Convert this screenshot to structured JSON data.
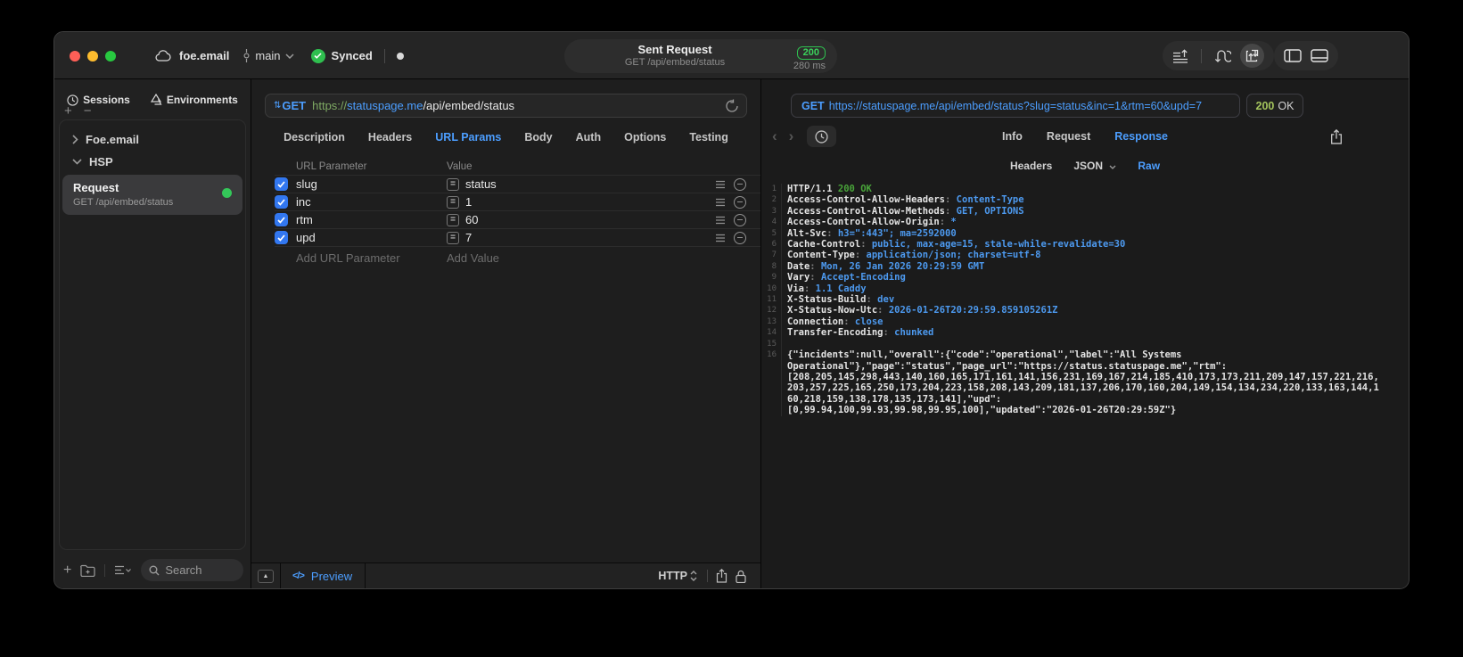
{
  "titlebar": {
    "project": "foe.email",
    "branch": "main",
    "sync_label": "Synced",
    "request_title": "Sent Request",
    "request_subtitle": "GET /api/embed/status",
    "status_badge": "200",
    "duration": "280 ms"
  },
  "sidebar": {
    "tabs": [
      {
        "label": "Sessions"
      },
      {
        "label": "Environments"
      }
    ],
    "tree": [
      {
        "label": "Foe.email"
      },
      {
        "label": "HSP"
      }
    ],
    "request_item": {
      "title": "Request",
      "subtitle": "GET /api/embed/status"
    },
    "search_placeholder": "Search"
  },
  "request_panel": {
    "method": "GET",
    "url": {
      "scheme": "https://",
      "host": "statuspage.me",
      "path": "/api/embed/status"
    },
    "tabs": [
      "Description",
      "Headers",
      "URL Params",
      "Body",
      "Auth",
      "Options",
      "Testing"
    ],
    "active_tab": "URL Params",
    "params": {
      "col_name": "URL Parameter",
      "col_value": "Value",
      "rows": [
        {
          "name": "slug",
          "value": "status",
          "enabled": true
        },
        {
          "name": "inc",
          "value": "1",
          "enabled": true
        },
        {
          "name": "rtm",
          "value": "60",
          "enabled": true
        },
        {
          "name": "upd",
          "value": "7",
          "enabled": true
        }
      ],
      "add_name": "Add URL Parameter",
      "add_value": "Add Value"
    },
    "footer": {
      "preview": "Preview",
      "protocol": "HTTP"
    }
  },
  "response_panel": {
    "method": "GET",
    "url": "https://statuspage.me/api/embed/status?slug=status&inc=1&rtm=60&upd=7",
    "status_code": "200",
    "status_text": "OK",
    "tabs": [
      "Info",
      "Request",
      "Response"
    ],
    "active_tab": "Response",
    "view_tabs": [
      "Headers",
      "JSON",
      "Raw"
    ],
    "active_view": "Raw",
    "body_lines": [
      {
        "n": "1",
        "parts": [
          {
            "t": "HTTP/1.1 ",
            "c": "w"
          },
          {
            "t": "200 OK",
            "c": "g"
          }
        ]
      },
      {
        "n": "2",
        "parts": [
          {
            "t": "Access-Control-Allow-Headers",
            "c": "w"
          },
          {
            "t": ": ",
            "c": "p"
          },
          {
            "t": "Content-Type",
            "c": "b"
          }
        ]
      },
      {
        "n": "3",
        "parts": [
          {
            "t": "Access-Control-Allow-Methods",
            "c": "w"
          },
          {
            "t": ": ",
            "c": "p"
          },
          {
            "t": "GET, OPTIONS",
            "c": "b"
          }
        ]
      },
      {
        "n": "4",
        "parts": [
          {
            "t": "Access-Control-Allow-Origin",
            "c": "w"
          },
          {
            "t": ": ",
            "c": "p"
          },
          {
            "t": "*",
            "c": "b"
          }
        ]
      },
      {
        "n": "5",
        "parts": [
          {
            "t": "Alt-Svc",
            "c": "w"
          },
          {
            "t": ": ",
            "c": "p"
          },
          {
            "t": "h3=\":443\"; ma=2592000",
            "c": "b"
          }
        ]
      },
      {
        "n": "6",
        "parts": [
          {
            "t": "Cache-Control",
            "c": "w"
          },
          {
            "t": ": ",
            "c": "p"
          },
          {
            "t": "public, max-age=15, stale-while-revalidate=30",
            "c": "b"
          }
        ]
      },
      {
        "n": "7",
        "parts": [
          {
            "t": "Content-Type",
            "c": "w"
          },
          {
            "t": ": ",
            "c": "p"
          },
          {
            "t": "application/json; charset=utf-8",
            "c": "b"
          }
        ]
      },
      {
        "n": "8",
        "parts": [
          {
            "t": "Date",
            "c": "w"
          },
          {
            "t": ": ",
            "c": "p"
          },
          {
            "t": "Mon, 26 Jan 2026 20:29:59 GMT",
            "c": "b"
          }
        ]
      },
      {
        "n": "9",
        "parts": [
          {
            "t": "Vary",
            "c": "w"
          },
          {
            "t": ": ",
            "c": "p"
          },
          {
            "t": "Accept-Encoding",
            "c": "b"
          }
        ]
      },
      {
        "n": "10",
        "parts": [
          {
            "t": "Via",
            "c": "w"
          },
          {
            "t": ": ",
            "c": "p"
          },
          {
            "t": "1.1 Caddy",
            "c": "b"
          }
        ]
      },
      {
        "n": "11",
        "parts": [
          {
            "t": "X-Status-Build",
            "c": "w"
          },
          {
            "t": ": ",
            "c": "p"
          },
          {
            "t": "dev",
            "c": "b"
          }
        ]
      },
      {
        "n": "12",
        "parts": [
          {
            "t": "X-Status-Now-Utc",
            "c": "w"
          },
          {
            "t": ": ",
            "c": "p"
          },
          {
            "t": "2026-01-26T20:29:59.859105261Z",
            "c": "b"
          }
        ]
      },
      {
        "n": "13",
        "parts": [
          {
            "t": "Connection",
            "c": "w"
          },
          {
            "t": ": ",
            "c": "p"
          },
          {
            "t": "close",
            "c": "b"
          }
        ]
      },
      {
        "n": "14",
        "parts": [
          {
            "t": "Transfer-Encoding",
            "c": "w"
          },
          {
            "t": ": ",
            "c": "p"
          },
          {
            "t": "chunked",
            "c": "b"
          }
        ]
      },
      {
        "n": "15",
        "parts": []
      },
      {
        "n": "16",
        "parts": [
          {
            "t": "{\"incidents\":null,\"overall\":{\"code\":\"operational\",\"label\":\"All Systems",
            "c": "w"
          }
        ]
      },
      {
        "n": "",
        "parts": [
          {
            "t": "Operational\"},\"page\":\"status\",\"page_url\":\"https://status.statuspage.me\",\"rtm\":",
            "c": "w"
          }
        ]
      },
      {
        "n": "",
        "parts": [
          {
            "t": "[208,205,145,298,443,140,160,165,171,161,141,156,231,169,167,214,185,410,173,173,211,209,147,157,221,216,",
            "c": "w"
          }
        ]
      },
      {
        "n": "",
        "parts": [
          {
            "t": "203,257,225,165,250,173,204,223,158,208,143,209,181,137,206,170,160,204,149,154,134,234,220,133,163,144,1",
            "c": "w"
          }
        ]
      },
      {
        "n": "",
        "parts": [
          {
            "t": "60,218,159,138,178,135,173,141],\"upd\":",
            "c": "w"
          }
        ]
      },
      {
        "n": "",
        "parts": [
          {
            "t": "[0,99.94,100,99.93,99.98,99.95,100],\"updated\":\"2026-01-26T20:29:59Z\"}",
            "c": "w"
          }
        ]
      }
    ]
  },
  "icons": {
    "plus": "+",
    "minus": "−",
    "equals": "=",
    "code": "</>",
    "collapse_triangle": "▲",
    "updown": "⇅",
    "back_chevron": "‹",
    "forward_chevron": "›"
  },
  "colors": {
    "accent_blue": "#4c9eff",
    "sync_green": "#2fbf4f",
    "badge_green": "#3bd35c",
    "request_dot_green": "#34c759",
    "checkbox_blue": "#3277f0",
    "status_code_green": "#a3c35c",
    "body_value_blue": "#4d9af0",
    "body_status_green": "#49a53a",
    "url_scheme_green": "#7ea963"
  }
}
